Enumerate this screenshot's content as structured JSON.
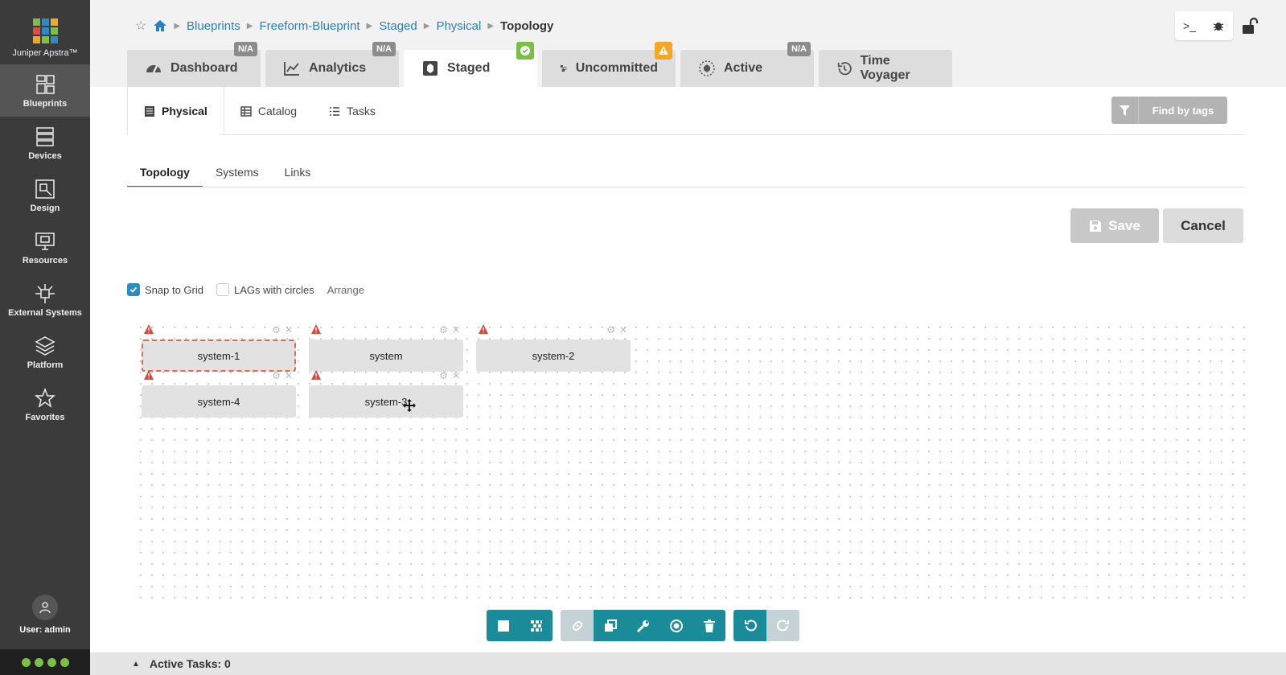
{
  "app": {
    "name": "Juniper Apstra™"
  },
  "colors": {
    "accent": "#1a8c99",
    "link": "#2a7fc1",
    "ok": "#7ac143",
    "warn": "#f5a623",
    "sidebar": "#3b3b3b"
  },
  "sidebar": {
    "items": [
      {
        "label": "Blueprints",
        "icon": "blueprints-icon"
      },
      {
        "label": "Devices",
        "icon": "devices-icon"
      },
      {
        "label": "Design",
        "icon": "design-icon"
      },
      {
        "label": "Resources",
        "icon": "resources-icon"
      },
      {
        "label": "External Systems",
        "icon": "external-systems-icon"
      },
      {
        "label": "Platform",
        "icon": "platform-icon"
      },
      {
        "label": "Favorites",
        "icon": "star-icon"
      }
    ],
    "user_label": "User: admin"
  },
  "breadcrumb": {
    "items": [
      "Blueprints",
      "Freeform-Blueprint",
      "Staged",
      "Physical"
    ],
    "current": "Topology"
  },
  "main_tabs": [
    {
      "label": "Dashboard",
      "badge": "N/A"
    },
    {
      "label": "Analytics",
      "badge": "N/A"
    },
    {
      "label": "Staged",
      "badge": ""
    },
    {
      "label": "Uncommitted",
      "badge": ""
    },
    {
      "label": "Active",
      "badge": "N/A"
    },
    {
      "label": "Time Voyager",
      "badge": ""
    }
  ],
  "sub_tabs": [
    "Physical",
    "Catalog",
    "Tasks"
  ],
  "find_by_tags": "Find by tags",
  "view_tabs": [
    "Topology",
    "Systems",
    "Links"
  ],
  "buttons": {
    "save": "Save",
    "cancel": "Cancel"
  },
  "options": {
    "snap_to_grid": "Snap to Grid",
    "lags_with_circles": "LAGs with circles",
    "arrange": "Arrange"
  },
  "nodes": [
    {
      "label": "system-1",
      "selected": true
    },
    {
      "label": "system",
      "selected": false
    },
    {
      "label": "system-2",
      "selected": false
    },
    {
      "label": "system-4",
      "selected": false
    },
    {
      "label": "system-3",
      "selected": false
    }
  ],
  "footer": {
    "active_tasks": "Active Tasks: 0"
  }
}
